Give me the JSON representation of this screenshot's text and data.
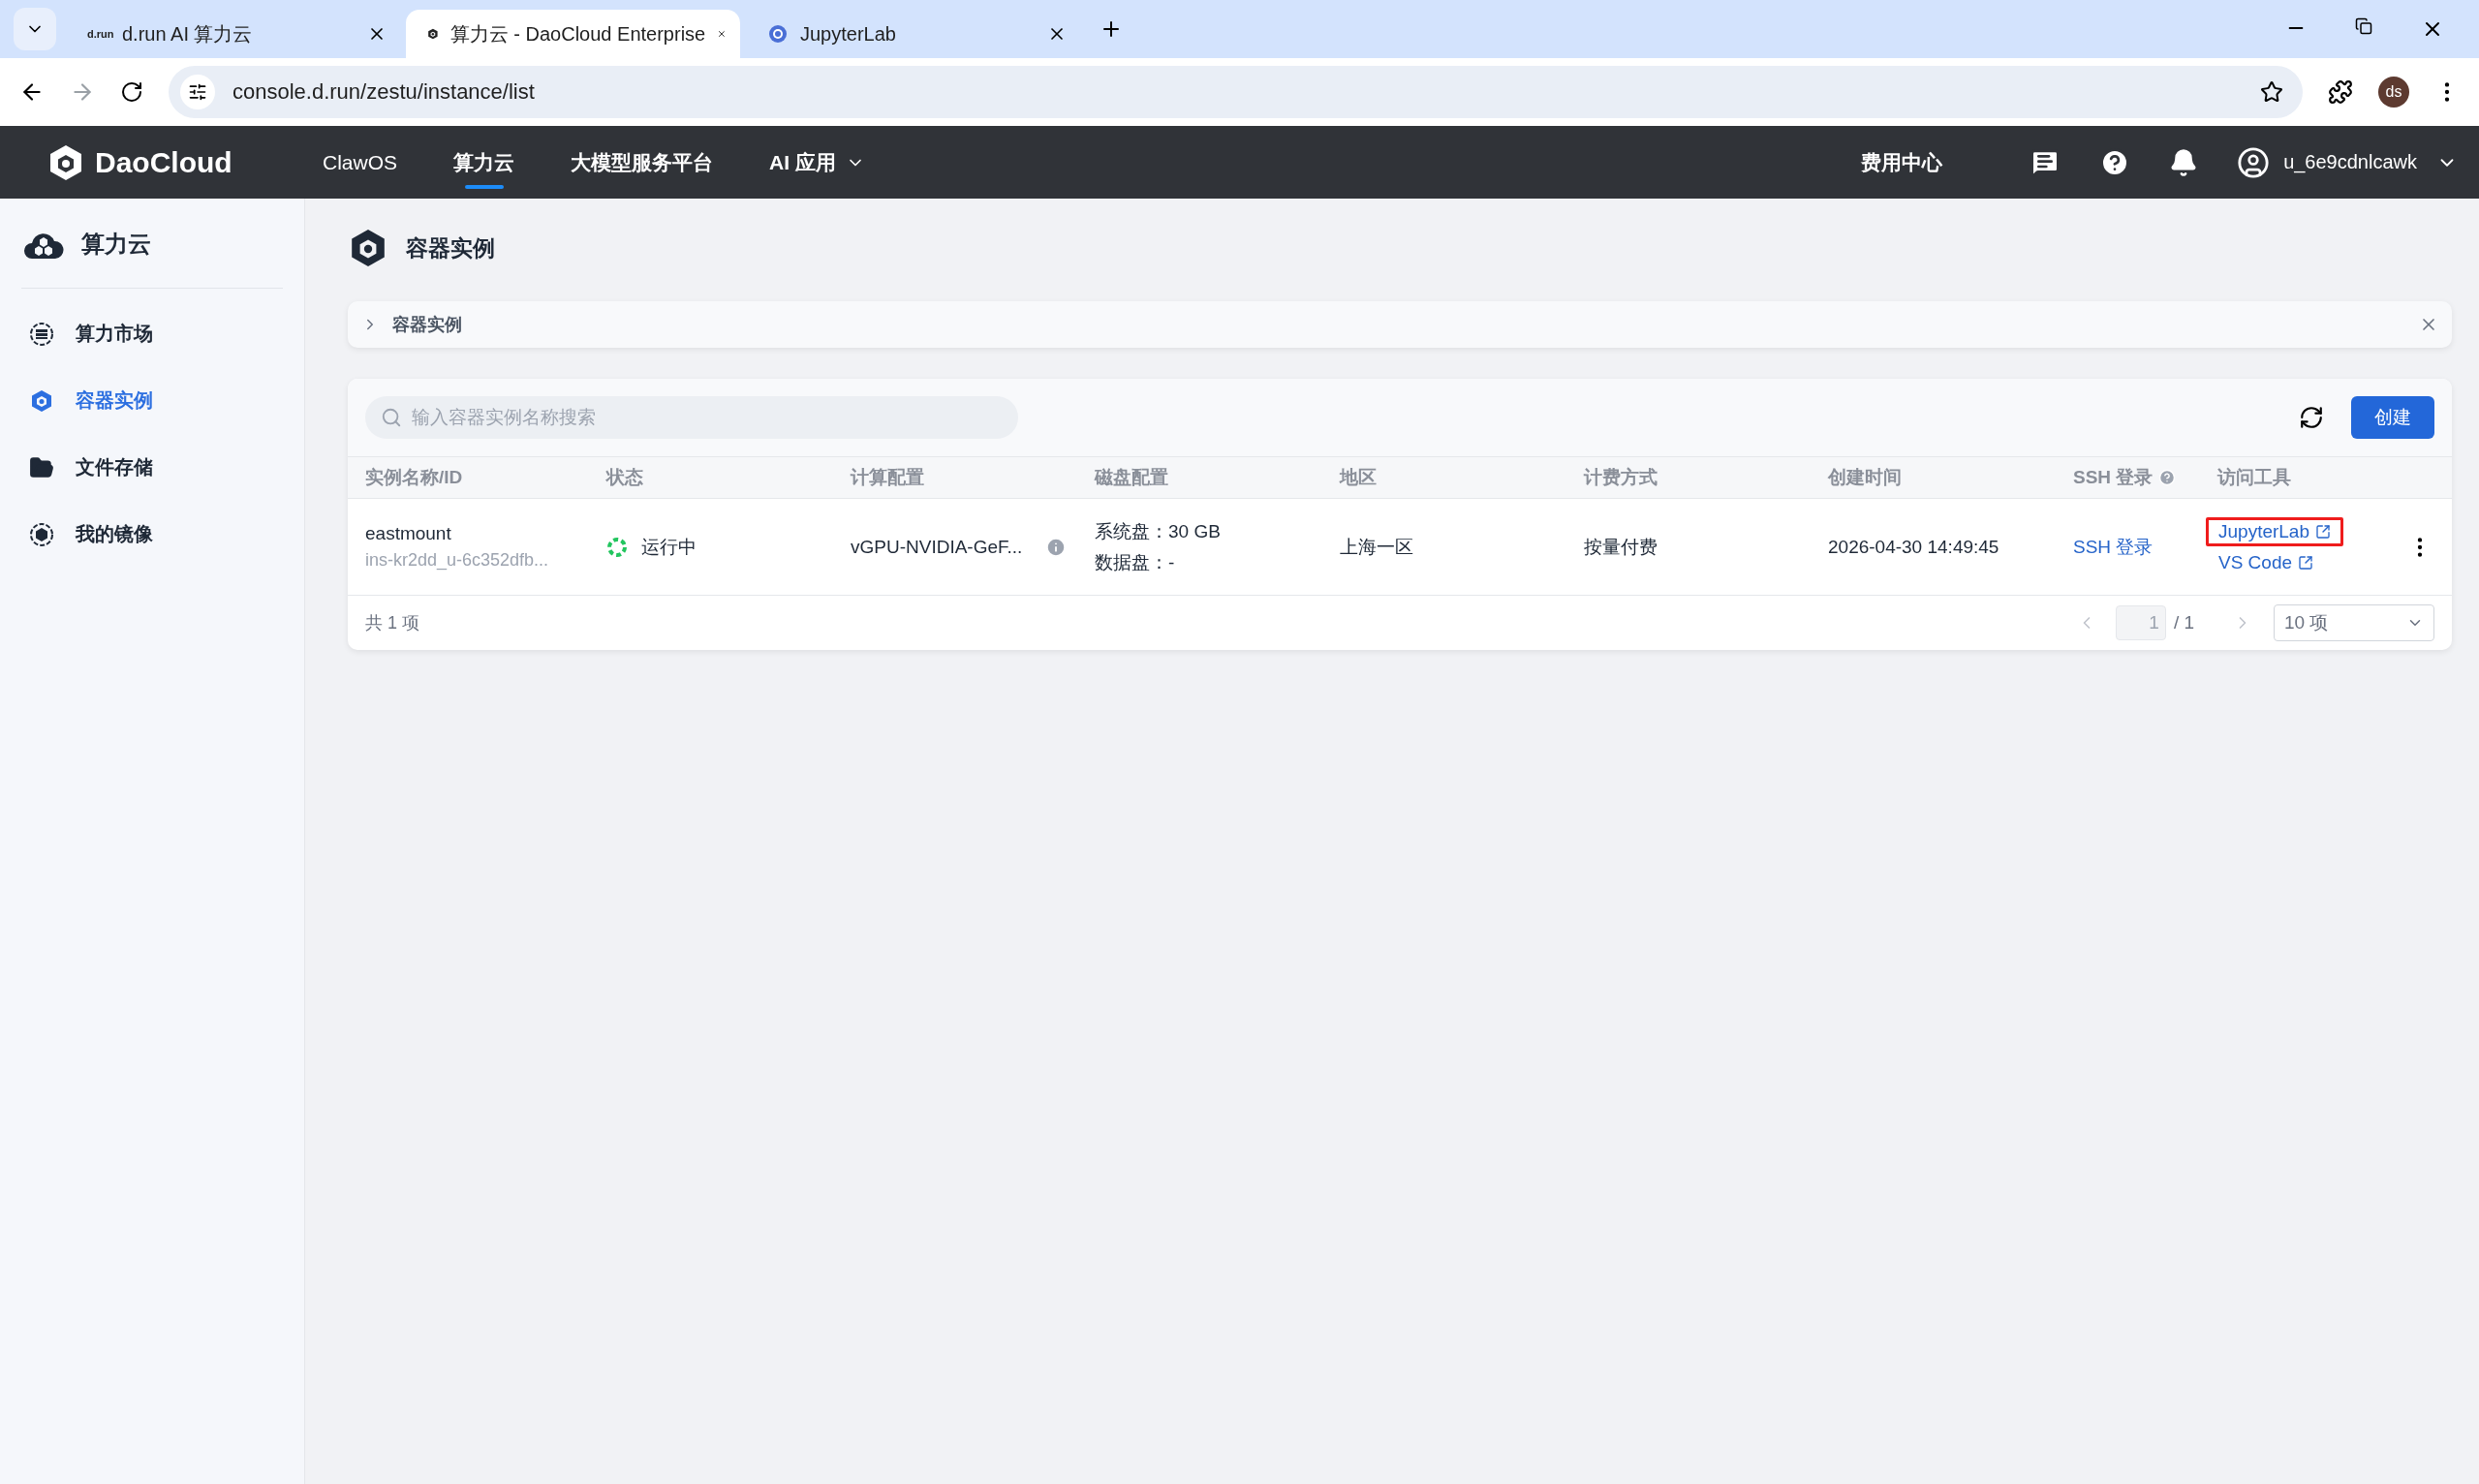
{
  "browser": {
    "tabs": [
      {
        "kind": "text",
        "favicon": "d.run",
        "title": "d.run AI 算力云",
        "selected": false
      },
      {
        "kind": "daocloud",
        "title": "算力云 - DaoCloud Enterprise",
        "selected": true
      },
      {
        "kind": "jupyter",
        "title": "JupyterLab",
        "selected": false
      }
    ],
    "url": "console.d.run/zestu/instance/list",
    "profile": "ds"
  },
  "nav": {
    "logo": "DaoCloud",
    "items": [
      {
        "label": "ClawOS",
        "selected": false,
        "menu": false
      },
      {
        "label": "算力云",
        "selected": true,
        "menu": false
      },
      {
        "label": "大模型服务平台",
        "selected": false,
        "menu": false
      },
      {
        "label": "AI 应用",
        "selected": false,
        "menu": true
      }
    ],
    "cost_center": "费用中心",
    "user": "u_6e9cdnlcawk"
  },
  "sidebar": {
    "title": "算力云",
    "items": [
      {
        "kind": "market",
        "label": "算力市场",
        "selected": false
      },
      {
        "kind": "instance",
        "label": "容器实例",
        "selected": true
      },
      {
        "kind": "storage",
        "label": "文件存储",
        "selected": false
      },
      {
        "kind": "image",
        "label": "我的镜像",
        "selected": false
      }
    ]
  },
  "page": {
    "title": "容器实例",
    "breadcrumb": "容器实例"
  },
  "toolbar": {
    "search": {
      "placeholder": "输入容器实例名称搜索"
    },
    "create": "创建"
  },
  "table": {
    "columns": [
      {
        "label": "实例名称/ID",
        "help": false
      },
      {
        "label": "状态",
        "help": false
      },
      {
        "label": "计算配置",
        "help": false
      },
      {
        "label": "磁盘配置",
        "help": false
      },
      {
        "label": "地区",
        "help": false
      },
      {
        "label": "计费方式",
        "help": false
      },
      {
        "label": "创建时间",
        "help": false
      },
      {
        "label": "SSH 登录",
        "help": true
      },
      {
        "label": "访问工具",
        "help": false
      }
    ],
    "rows": [
      {
        "name": "eastmount",
        "id": "ins-kr2dd_u-6c352dfb...",
        "status": "运行中",
        "compute": "vGPU-NVIDIA-GeF...",
        "disk": [
          "系统盘：30 GB",
          "数据盘：-"
        ],
        "region": "上海一区",
        "billing": "按量付费",
        "created": "2026-04-30 14:49:45",
        "ssh": "SSH 登录",
        "tools": [
          {
            "label": "JupyterLab",
            "highlighted": true
          },
          {
            "label": "VS Code",
            "highlighted": false
          }
        ]
      }
    ]
  },
  "footer": {
    "total": "共 1 项",
    "page": "1",
    "pages": "/ 1",
    "page_size": "10 项"
  }
}
